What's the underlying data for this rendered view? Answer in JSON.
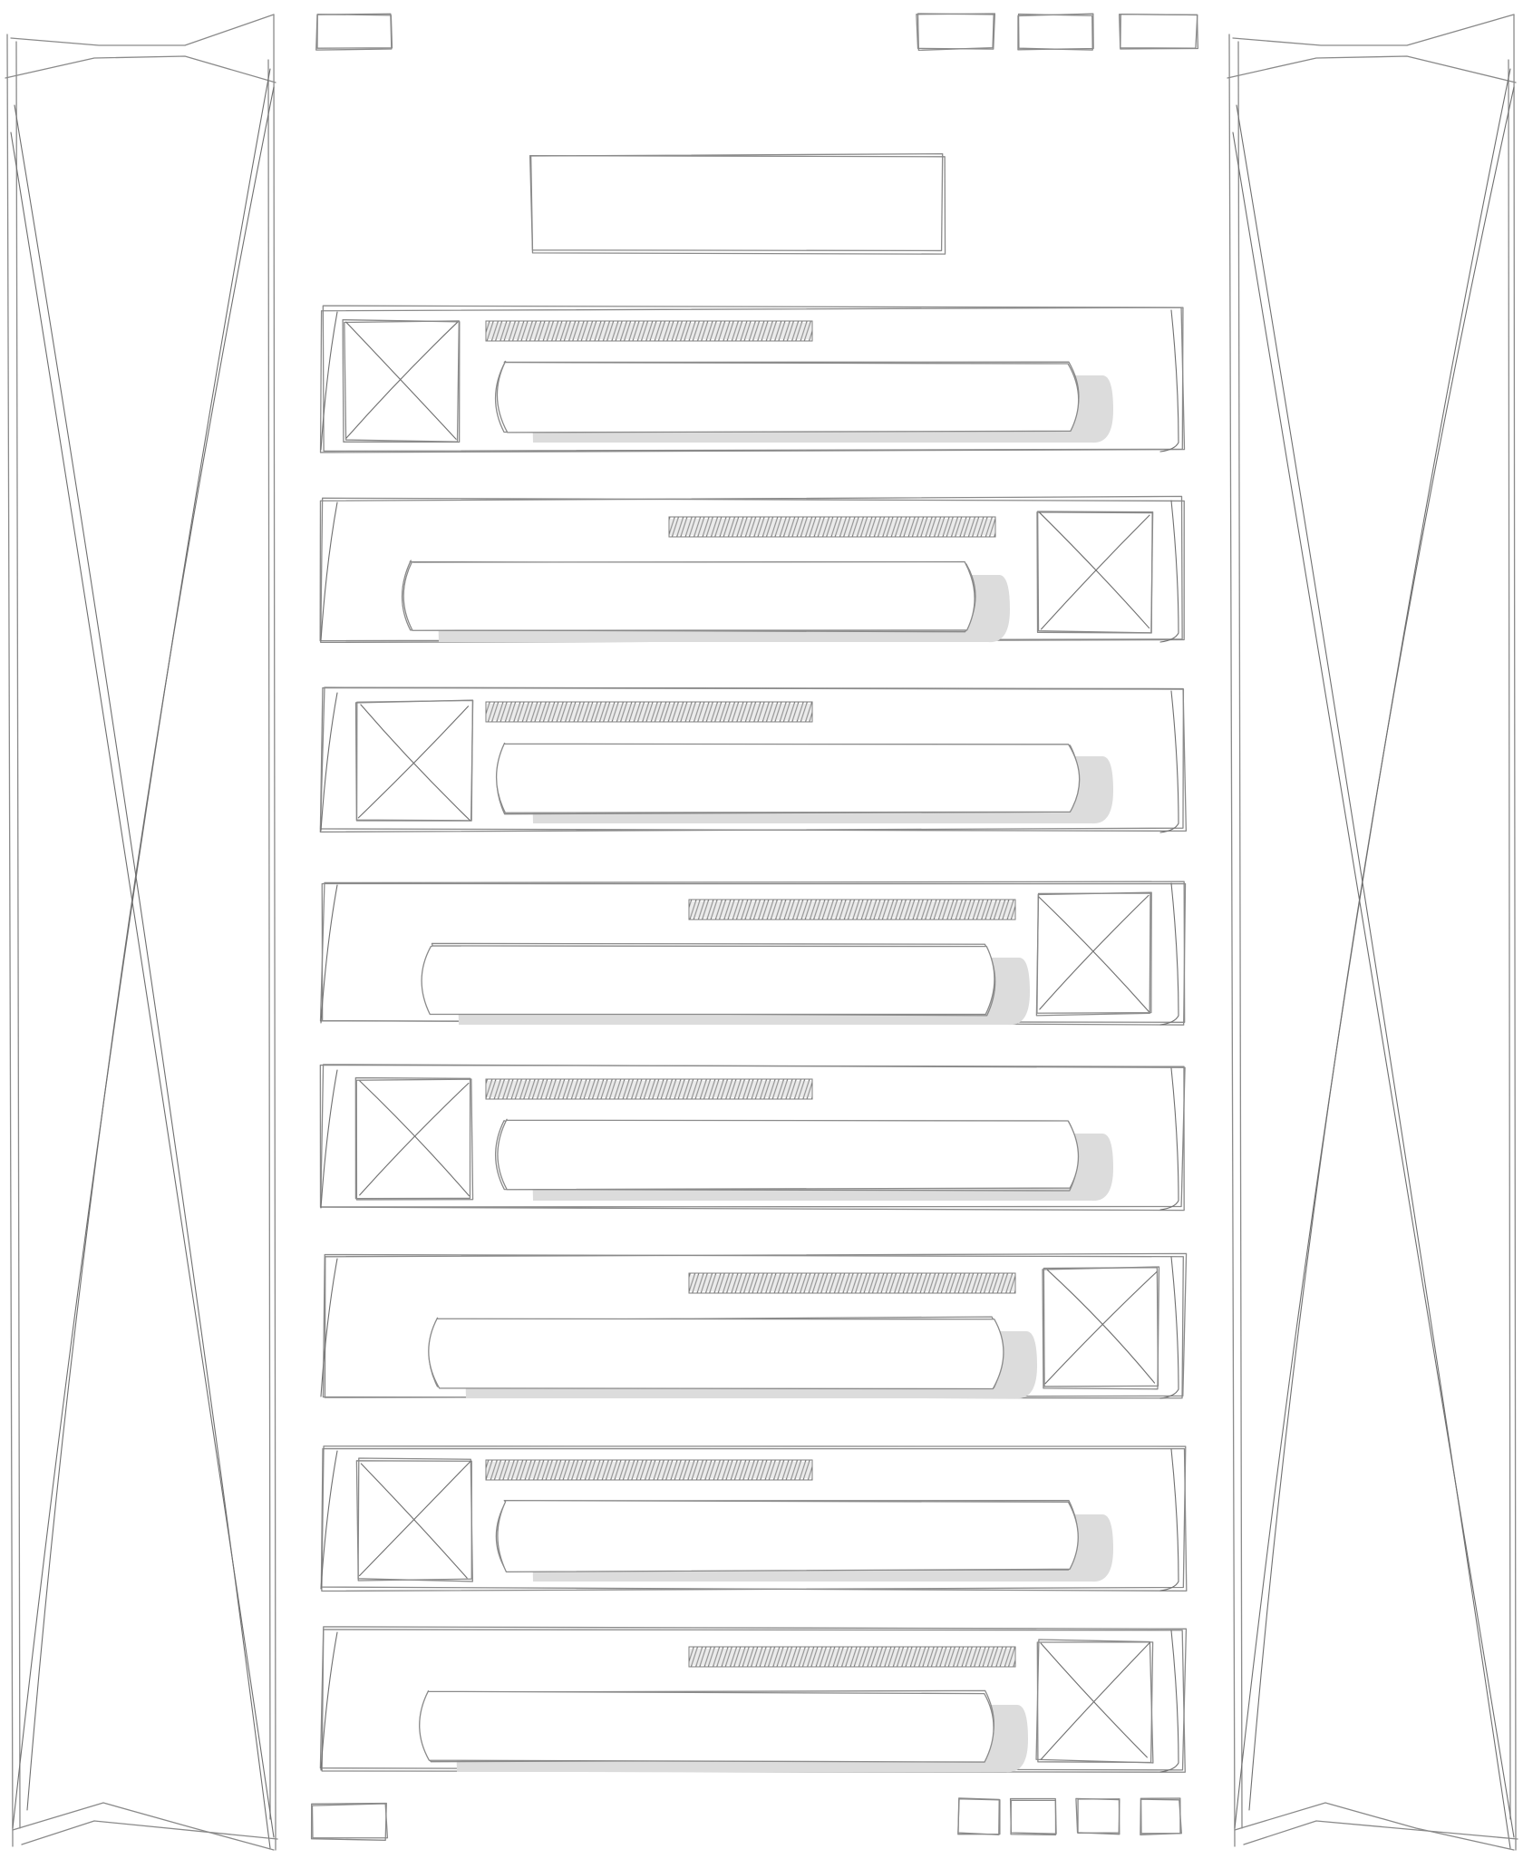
{
  "wireframe": {
    "style": "hand-drawn sketch",
    "stroke_color": "#8a8a8a",
    "shadow_color": "#dcdcdc",
    "header": {
      "logo": {
        "icon": "placeholder-box"
      },
      "nav_buttons": [
        {
          "icon": "placeholder-box"
        },
        {
          "icon": "placeholder-box"
        },
        {
          "icon": "placeholder-box"
        }
      ]
    },
    "sidebars": {
      "left": {
        "icon": "image-placeholder-icon"
      },
      "right": {
        "icon": "image-placeholder-icon"
      }
    },
    "title_box": {
      "icon": "placeholder-box"
    },
    "cards": [
      {
        "image_side": "left"
      },
      {
        "image_side": "right"
      },
      {
        "image_side": "left"
      },
      {
        "image_side": "right"
      },
      {
        "image_side": "left"
      },
      {
        "image_side": "right"
      },
      {
        "image_side": "left"
      },
      {
        "image_side": "right"
      }
    ],
    "footer": {
      "logo": {
        "icon": "placeholder-box"
      },
      "buttons": [
        {
          "icon": "placeholder-box"
        },
        {
          "icon": "placeholder-box"
        },
        {
          "icon": "placeholder-box"
        },
        {
          "icon": "placeholder-box"
        }
      ]
    }
  }
}
